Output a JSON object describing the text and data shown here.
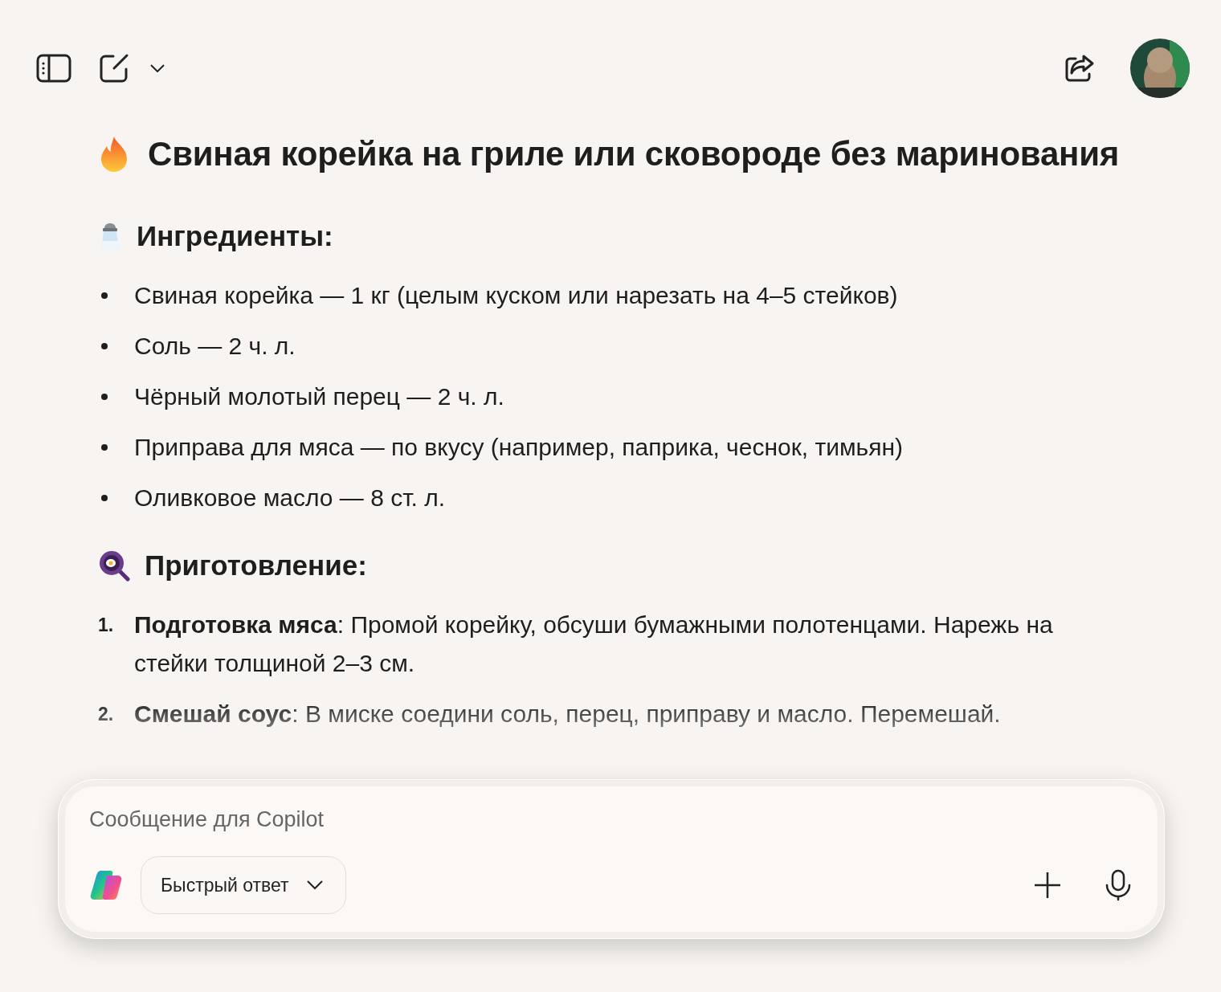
{
  "title": "Свиная корейка на гриле или сковороде без маринования",
  "sections": [
    {
      "kind": "bullets",
      "heading": "Ингредиенты:",
      "items": [
        "Свиная корейка — 1 кг (целым куском или нарезать на 4–5 стейков)",
        "Соль — 2 ч. л.",
        "Чёрный молотый перец — 2 ч. л.",
        "Приправа для мяса — по вкусу (например, паприка, чеснок, тимьян)",
        "Оливковое масло — 8 ст. л."
      ]
    },
    {
      "kind": "steps",
      "heading": "Приготовление:",
      "items": [
        {
          "number": "1.",
          "text": "**Подготовка мяса**: Промой корейку, обсуши бумажными полотенцами. Нарежь на стейки толщиной 2–3 см."
        },
        {
          "number": "2.",
          "text": "**Смешай соус**: В миске соедини соль, перец, приправу и масло. Перемешай."
        }
      ]
    }
  ],
  "composer": {
    "placeholder": "Сообщение для Copilot",
    "mode": "Быстрый ответ"
  }
}
